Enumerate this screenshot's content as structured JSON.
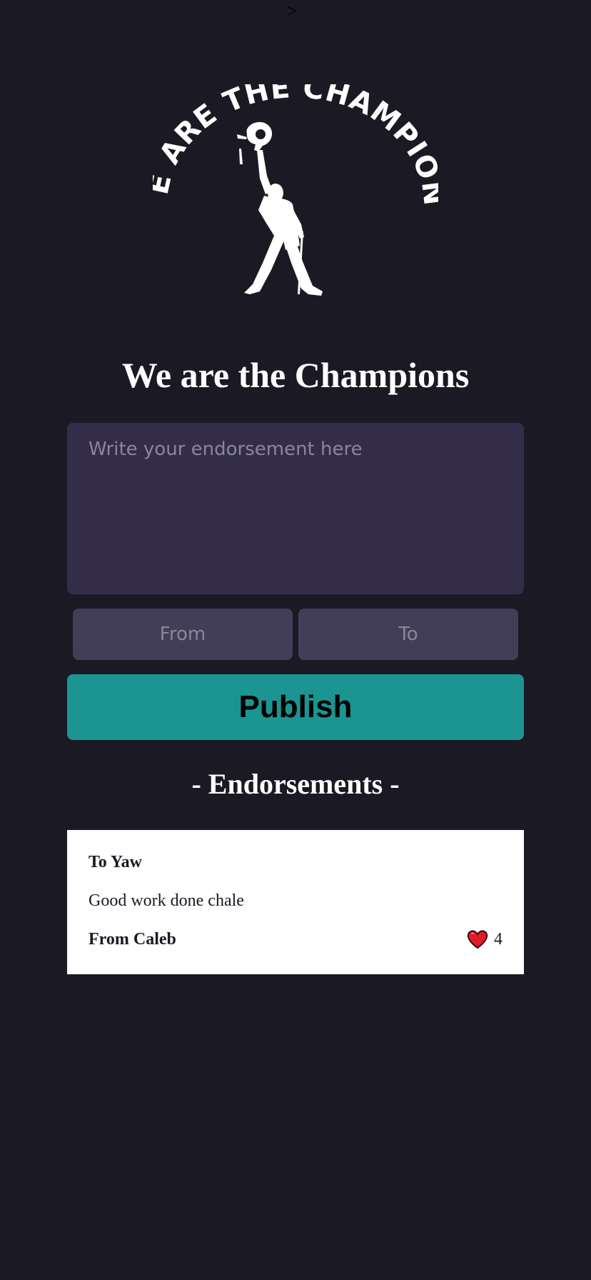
{
  "page": {
    "stray_char": ">",
    "title": "We are the Champions",
    "logo_text": "WE ARE THE CHAMPIONS"
  },
  "form": {
    "endorsement_placeholder": "Write your endorsement here",
    "endorsement_value": "",
    "from_placeholder": "From",
    "from_value": "",
    "to_placeholder": "To",
    "to_value": "",
    "publish_label": "Publish"
  },
  "endorsements": {
    "heading": "- Endorsements -",
    "items": [
      {
        "to": "To Yaw",
        "message": "Good work done chale",
        "from": "From Caleb",
        "likes": "4"
      }
    ]
  },
  "colors": {
    "background": "#1b1924",
    "textarea": "#332d4a",
    "small_input": "#433e58",
    "publish": "#1a9591",
    "heart": "#e21b2a"
  },
  "icons": {
    "logo": "champion-silhouette-logo",
    "like": "heart-icon"
  }
}
